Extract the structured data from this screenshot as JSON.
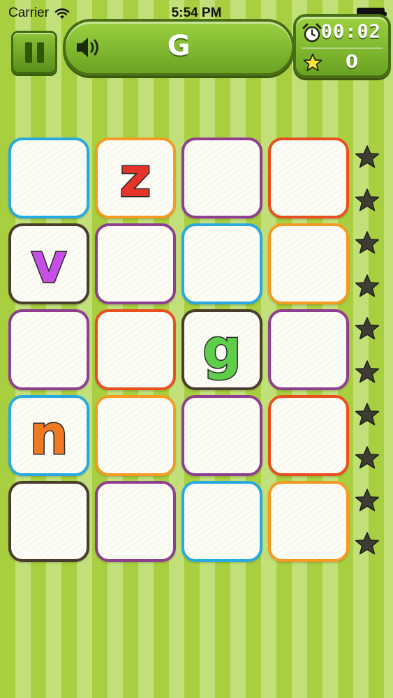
{
  "status_bar": {
    "carrier": "Carrier",
    "time": "5:54 PM"
  },
  "hud": {
    "target_letter": "G",
    "timer": "00:02",
    "score": "0"
  },
  "colors": {
    "blue": "#29a9e0",
    "orange": "#f59a23",
    "purple": "#8e3f8f",
    "red": "#e8501f",
    "dark": "#4a3d2c"
  },
  "board": {
    "rows": [
      [
        {
          "border": "blue",
          "letter": "",
          "letter_color": ""
        },
        {
          "border": "orange",
          "letter": "z",
          "letter_color": "#e5342a"
        },
        {
          "border": "purple",
          "letter": "",
          "letter_color": ""
        },
        {
          "border": "red",
          "letter": "",
          "letter_color": ""
        }
      ],
      [
        {
          "border": "dark",
          "letter": "v",
          "letter_color": "#c84ee8"
        },
        {
          "border": "purple",
          "letter": "",
          "letter_color": ""
        },
        {
          "border": "blue",
          "letter": "",
          "letter_color": ""
        },
        {
          "border": "orange",
          "letter": "",
          "letter_color": ""
        }
      ],
      [
        {
          "border": "purple",
          "letter": "",
          "letter_color": ""
        },
        {
          "border": "red",
          "letter": "",
          "letter_color": ""
        },
        {
          "border": "dark",
          "letter": "g",
          "letter_color": "#5fcf4a"
        },
        {
          "border": "purple",
          "letter": "",
          "letter_color": ""
        }
      ],
      [
        {
          "border": "blue",
          "letter": "n",
          "letter_color": "#f07a23"
        },
        {
          "border": "orange",
          "letter": "",
          "letter_color": ""
        },
        {
          "border": "purple",
          "letter": "",
          "letter_color": ""
        },
        {
          "border": "red",
          "letter": "",
          "letter_color": ""
        }
      ],
      [
        {
          "border": "dark",
          "letter": "",
          "letter_color": ""
        },
        {
          "border": "purple",
          "letter": "",
          "letter_color": ""
        },
        {
          "border": "blue",
          "letter": "",
          "letter_color": ""
        },
        {
          "border": "orange",
          "letter": "",
          "letter_color": ""
        }
      ]
    ]
  },
  "progress": {
    "stars_total": 10,
    "stars_earned": 0,
    "earned_color": "#ffd83a",
    "empty_color": "#3d3d33"
  }
}
